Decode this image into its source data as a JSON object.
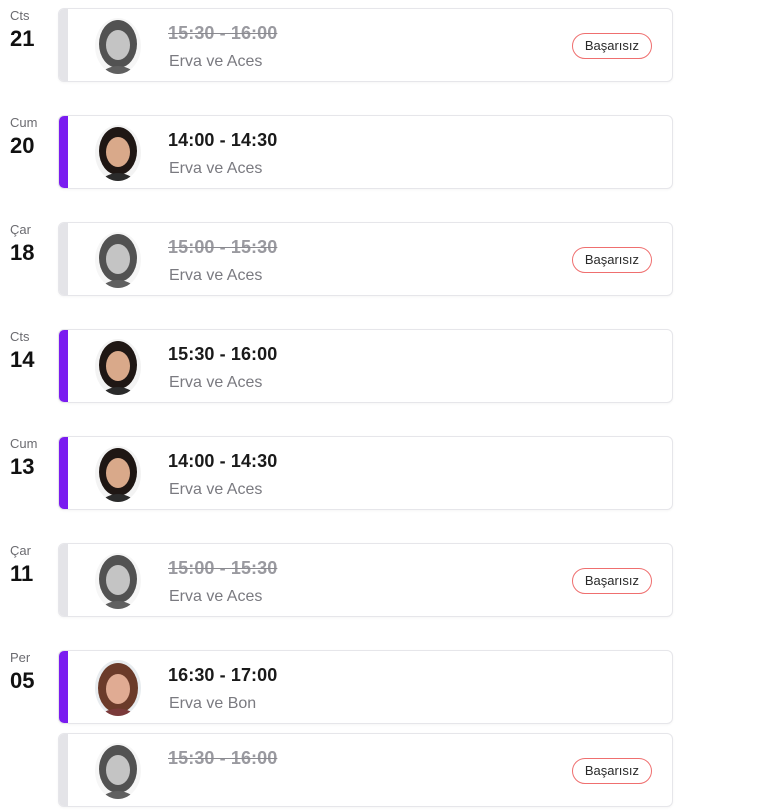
{
  "colors": {
    "accent_active": "#7a1cf0",
    "accent_inactive": "#e4e4e8",
    "badge_border": "#ef6f6f"
  },
  "lessons": [
    {
      "dow": "Cts",
      "day": "21",
      "time": "15:30 - 16:00",
      "title": "Erva ve Aces",
      "status": "failed",
      "badge": "Başarısız",
      "avatar": "tutor-aces-avatar"
    },
    {
      "dow": "Cum",
      "day": "20",
      "time": "14:00 - 14:30",
      "title": "Erva ve Aces",
      "status": "completed",
      "badge": "",
      "avatar": "tutor-aces-avatar"
    },
    {
      "dow": "Çar",
      "day": "18",
      "time": "15:00 - 15:30",
      "title": "Erva ve Aces",
      "status": "failed",
      "badge": "Başarısız",
      "avatar": "tutor-aces-avatar"
    },
    {
      "dow": "Cts",
      "day": "14",
      "time": "15:30 - 16:00",
      "title": "Erva ve Aces",
      "status": "completed",
      "badge": "",
      "avatar": "tutor-aces-avatar"
    },
    {
      "dow": "Cum",
      "day": "13",
      "time": "14:00 - 14:30",
      "title": "Erva ve Aces",
      "status": "completed",
      "badge": "",
      "avatar": "tutor-aces-avatar"
    },
    {
      "dow": "Çar",
      "day": "11",
      "time": "15:00 - 15:30",
      "title": "Erva ve Aces",
      "status": "failed",
      "badge": "Başarısız",
      "avatar": "tutor-aces-avatar"
    },
    {
      "dow": "Per",
      "day": "05",
      "time": "16:30 - 17:00",
      "title": "Erva ve Bon",
      "status": "completed",
      "badge": "",
      "avatar": "tutor-bon-avatar"
    },
    {
      "dow": "",
      "day": "",
      "time": "15:30 - 16:00",
      "title": "",
      "status": "failed",
      "badge": "Başarısız",
      "avatar": "tutor-aces-avatar"
    }
  ]
}
